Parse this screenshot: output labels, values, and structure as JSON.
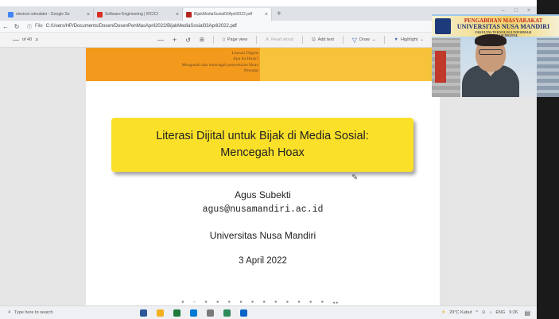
{
  "browser": {
    "tabs": [
      {
        "label": "electron simulator - Google Se",
        "favicon_color": "#4285f4",
        "active": false
      },
      {
        "label": "Software Engineering | IDC/CI",
        "favicon_color": "#d93025",
        "active": false
      },
      {
        "label": "BijakMediaSosial03April2022.pdf",
        "favicon_color": "#b3261e",
        "active": true
      }
    ],
    "close_glyph": "×",
    "new_tab_glyph": "+",
    "window_controls": [
      "–",
      "□",
      "×"
    ]
  },
  "address_bar": {
    "file_label": "File",
    "url": "C:/Users/HP/Documents/Dosen/DosenPenMasApril2022/BijakMediaSosial03April2022.pdf"
  },
  "pdf_toolbar": {
    "page_indicator": "of 40",
    "zoom_out": "—",
    "zoom_in": "+",
    "page_view": "Page view",
    "read_aloud": "Read aloud",
    "add_text": "Add text",
    "draw": "Draw",
    "highlight": "Highlight"
  },
  "slide": {
    "toc": [
      "Literasi Digital",
      "Apa itu Hoax?",
      "Mengenali dan mencegah penyebaran Hoax",
      "Penutup"
    ],
    "title_line1": "Literasi Dijital untuk Bijak di Media Sosial:",
    "title_line2": "Mencegah Hoax",
    "author": "Agus Subekti",
    "email": "agus@nusamandiri.ac.id",
    "institution": "Universitas Nusa Mandiri",
    "date": "3 April 2022",
    "colors": {
      "header_left": "#f39a1d",
      "header_right": "#f7c33b",
      "title_box": "#fbe02a"
    }
  },
  "webcam": {
    "banner_line1": "PENGABDIAN MASYARAKAT",
    "banner_line2": "UNIVERSITAS NUSA MANDIRI",
    "banner_line3": "FAKULTAS TEKNOLOGI INFORMASI",
    "banner_line4": "LITERASI DIGITAL"
  },
  "taskbar": {
    "search_placeholder": "Type here to search",
    "weather": "29°C Kabut",
    "lang": "ENG",
    "time": "9:26",
    "apps": [
      "#2b579a",
      "#f2b01e",
      "#1f7a3b",
      "#0078d4",
      "#7a7a7a",
      "#2e8b57",
      "#0a64c8"
    ]
  }
}
